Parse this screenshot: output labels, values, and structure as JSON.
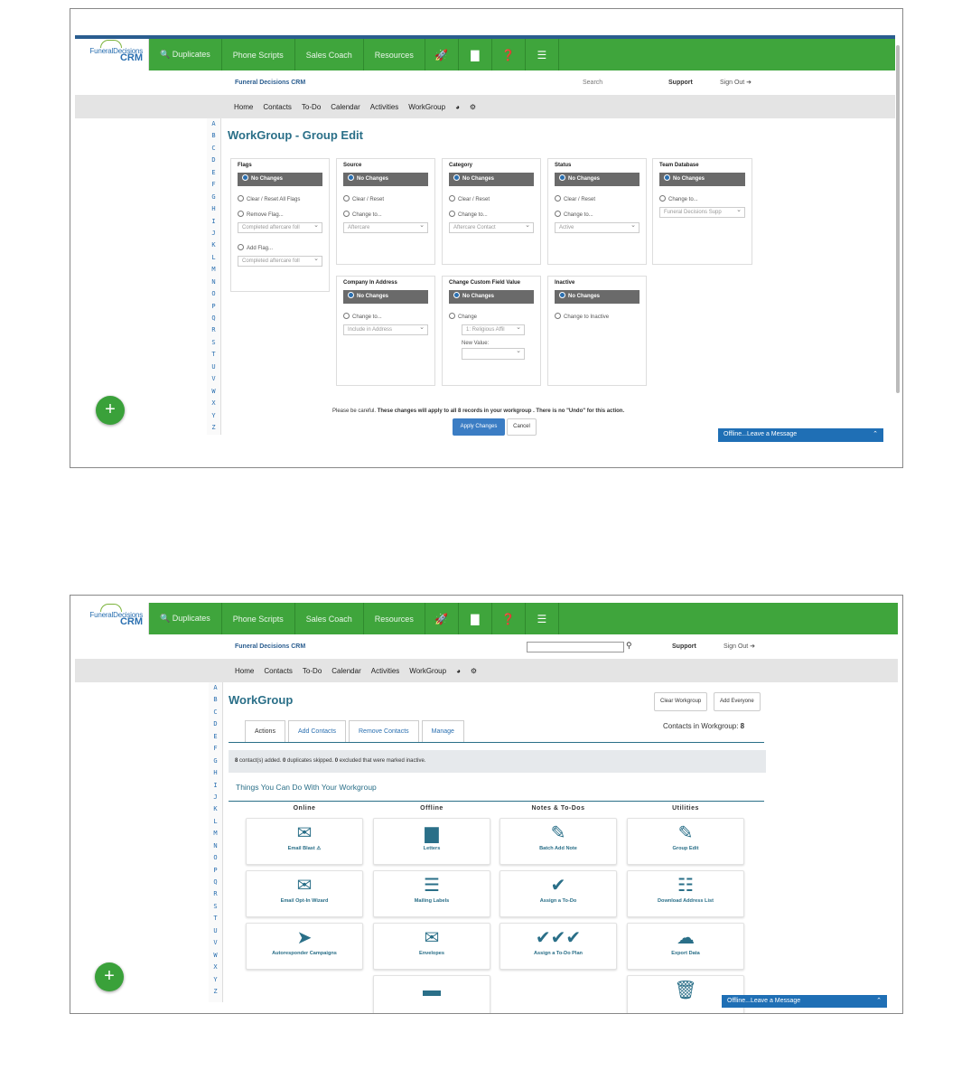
{
  "logo": {
    "line1": "FuneralDecisions",
    "line2": "CRM"
  },
  "nav": {
    "duplicates": "🔍 Duplicates",
    "scripts": "Phone Scripts",
    "coach": "Sales Coach",
    "resources": "Resources",
    "i1": "🚀",
    "i2": "▇",
    "i3": "❓",
    "i4": "☰"
  },
  "sub": {
    "brand": "Funeral Decisions CRM",
    "search": "Search",
    "support": "Support",
    "signout": "Sign Out ➜"
  },
  "menu": {
    "home": "Home",
    "contacts": "Contacts",
    "todo": "To-Do",
    "calendar": "Calendar",
    "activities": "Activities",
    "workgroup": "WorkGroup",
    "pie": "◕",
    "gear": "⚙"
  },
  "alphabet": [
    "A",
    "B",
    "C",
    "D",
    "E",
    "F",
    "G",
    "H",
    "I",
    "J",
    "K",
    "L",
    "M",
    "N",
    "O",
    "P",
    "Q",
    "R",
    "S",
    "T",
    "U",
    "V",
    "W",
    "X",
    "Y",
    "Z"
  ],
  "edit": {
    "title": "WorkGroup - Group Edit",
    "nochanges": "No Changes",
    "flags": {
      "title": "Flags",
      "clear": "Clear / Reset All Flags",
      "remove": "Remove Flag...",
      "remove_sel": "Completed aftercare foll",
      "add": "Add Flag...",
      "add_sel": "Completed aftercare foll"
    },
    "source": {
      "title": "Source",
      "clear": "Clear / Reset",
      "change": "Change to...",
      "sel": "Aftercare"
    },
    "category": {
      "title": "Category",
      "clear": "Clear / Reset",
      "change": "Change to...",
      "sel": "Aftercare Contact"
    },
    "status": {
      "title": "Status",
      "clear": "Clear / Reset",
      "change": "Change to...",
      "sel": "Active"
    },
    "team": {
      "title": "Team Database",
      "change": "Change to...",
      "sel": "Funeral Decisions Supp"
    },
    "company": {
      "title": "Company In Address",
      "change": "Change to...",
      "sel": "Include in Address"
    },
    "custom": {
      "title": "Change Custom Field Value",
      "change": "Change",
      "sel": "1: Religious Affil",
      "newval": "New Value:"
    },
    "inactive": {
      "title": "Inactive",
      "change": "Change to Inactive"
    },
    "warn_pre": "Please be careful.",
    "warn_bold": "These changes will apply to all 8 records in your workgroup . There is no \"Undo\" for this action.",
    "apply": "Apply Changes",
    "cancel": "Cancel"
  },
  "offline": "Offline...Leave a Message",
  "wg": {
    "title": "WorkGroup",
    "clear": "Clear Workgroup",
    "addall": "Add Everyone",
    "tabs": [
      "Actions",
      "Add Contacts",
      "Remove Contacts",
      "Manage"
    ],
    "count_label": "Contacts in Workgroup: ",
    "count": "8",
    "notice_a": "8",
    "notice_b": " contact(s) added. ",
    "notice_c": "0",
    "notice_d": " duplicates skipped. ",
    "notice_e": "0",
    "notice_f": " excluded that were marked inactive.",
    "things": "Things You Can Do With Your Workgroup",
    "cols": [
      "Online",
      "Offline",
      "Notes & To-Dos",
      "Utilities"
    ],
    "cards": [
      {
        "label": "Email Blast ⚠",
        "icon": "✉"
      },
      {
        "label": "Letters",
        "icon": "▆"
      },
      {
        "label": "Batch Add Note",
        "icon": "✎"
      },
      {
        "label": "Group Edit",
        "icon": "✎"
      },
      {
        "label": "Email Opt-In Wizard",
        "icon": "✉"
      },
      {
        "label": "Mailing Labels",
        "icon": "☰"
      },
      {
        "label": "Assign a To-Do",
        "icon": "✔"
      },
      {
        "label": "Download Address List",
        "icon": "☷"
      },
      {
        "label": "Autoresponder Campaigns",
        "icon": "➤"
      },
      {
        "label": "Envelopes",
        "icon": "✉"
      },
      {
        "label": "Assign a To-Do Plan",
        "icon": "✔✔✔"
      },
      {
        "label": "Export Data",
        "icon": "☁"
      },
      {
        "label": "",
        "icon": "▬"
      },
      {
        "label": "",
        "icon": "🗑"
      }
    ]
  }
}
